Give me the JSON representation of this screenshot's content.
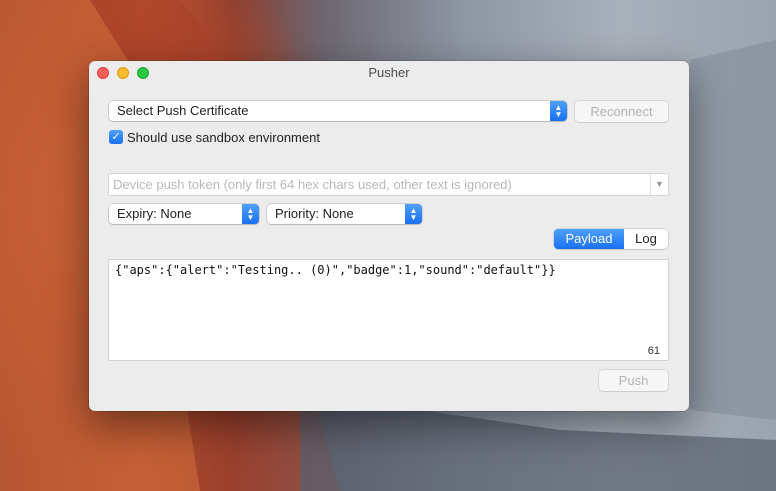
{
  "window": {
    "title": "Pusher"
  },
  "certificate": {
    "selected": "Select Push Certificate"
  },
  "reconnect": {
    "label": "Reconnect"
  },
  "sandbox": {
    "label": "Should use sandbox environment",
    "checked": true
  },
  "token": {
    "placeholder": "Device push token (only first 64 hex chars used, other text is ignored)",
    "value": ""
  },
  "expiry": {
    "selected": "Expiry: None"
  },
  "priority": {
    "selected": "Priority: None"
  },
  "tabs": {
    "payload": "Payload",
    "log": "Log",
    "active": "Payload"
  },
  "payload": {
    "text": "{\"aps\":{\"alert\":\"Testing.. (0)\",\"badge\":1,\"sound\":\"default\"}}",
    "char_count": "61"
  },
  "push": {
    "label": "Push"
  },
  "colors": {
    "accent": "#1a6ff1",
    "close": "#fc5f57",
    "minimize": "#fdbc2e",
    "maximize": "#29c840"
  }
}
